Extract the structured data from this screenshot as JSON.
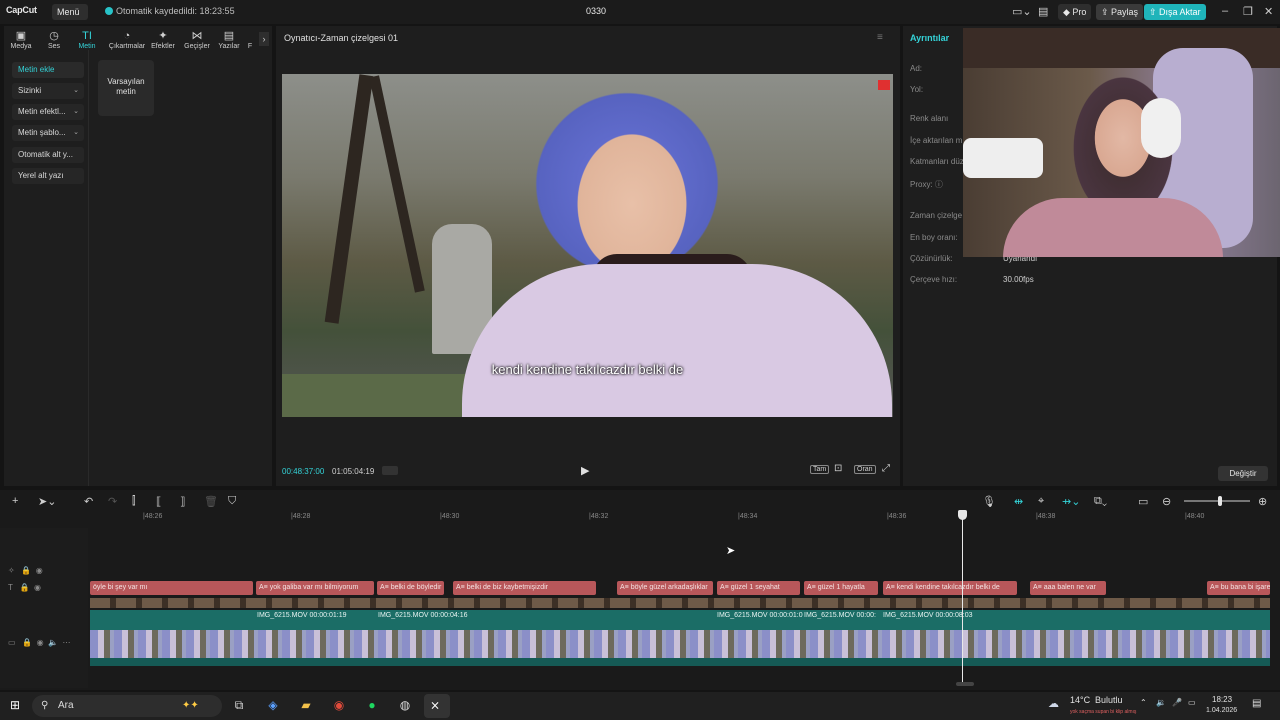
{
  "titlebar": {
    "logo": "CapCut",
    "menu": "Menü",
    "autosave": "Otomatik kaydedildi: 18:23:55",
    "project": "0330",
    "pro": "Pro",
    "share": "Paylaş",
    "export": "Dışa Aktar"
  },
  "tools": [
    {
      "label": "Medya",
      "icon": "▣"
    },
    {
      "label": "Ses",
      "icon": "◷"
    },
    {
      "label": "Metin",
      "icon": "TI"
    },
    {
      "label": "Çıkartmalar",
      "icon": "◔"
    },
    {
      "label": "Efektler",
      "icon": "✦"
    },
    {
      "label": "Geçişler",
      "icon": "⋈"
    },
    {
      "label": "Yazılar",
      "icon": "▤"
    },
    {
      "label": "F",
      "icon": "›"
    }
  ],
  "sidebar": [
    {
      "label": "Metin ekle",
      "active": true
    },
    {
      "label": "Sizinki"
    },
    {
      "label": "Metin efektl..."
    },
    {
      "label": "Metin şablo..."
    },
    {
      "label": "Otomatik alt y..."
    },
    {
      "label": "Yerel alt yazı"
    }
  ],
  "preset": {
    "line1": "Varsayılan",
    "line2": "metin"
  },
  "player": {
    "title": "Oynatıcı-Zaman çizelgesi 01",
    "subtitle": "kendi kendine takılcazdır belki de",
    "current_time": "00:48:37:00",
    "total_time": "01:05:04:19",
    "full": "Tam",
    "ratio": "Oran"
  },
  "details": {
    "title": "Ayrıntılar",
    "fields": [
      {
        "label": "Ad:",
        "value": ""
      },
      {
        "label": "Yol:",
        "value": ""
      },
      {
        "label": "Renk alanı",
        "value": ""
      },
      {
        "label": "İçe aktarılan m",
        "value": ""
      },
      {
        "label": "Katmanları düz",
        "value": ""
      },
      {
        "label": "Proxy:",
        "value": ""
      },
      {
        "label": "Zaman çizelge",
        "value": ""
      },
      {
        "label": "En boy oranı:",
        "value": ""
      },
      {
        "label": "Çözünürlük:",
        "value": "Uyarlandı"
      },
      {
        "label": "Çerçeve hızı:",
        "value": "30.00fps"
      }
    ],
    "change": "Değiştir"
  },
  "timeline": {
    "ruler": [
      "|48:26",
      "|48:28",
      "|48:30",
      "|48:32",
      "|48:34",
      "|48:36",
      "|48:38",
      "|48:40"
    ],
    "captions": [
      {
        "text": "öyle bi şey var mı"
      },
      {
        "text": "A≡ yok galiba var mı bilmiyorum"
      },
      {
        "text": "A≡ belki de böyledir"
      },
      {
        "text": "A≡ belki de biz kaybetmişizdir"
      },
      {
        "text": "A≡ böyle güzel arkadaşlıklar"
      },
      {
        "text": "A≡ güzel 1 seyahat"
      },
      {
        "text": "A≡ güzel 1 hayatla"
      },
      {
        "text": "A≡ kendi kendine takılcazdır belki de"
      },
      {
        "text": "A≡ aaa balen ne var"
      },
      {
        "text": "A≡ bu bana bi işare"
      }
    ],
    "clips": [
      {
        "text": "IMG_6215.MOV   00:00:01:19"
      },
      {
        "text": "IMG_6215.MOV   00:00:04:16"
      },
      {
        "text": "IMG_6215.MOV   00:00:01:0"
      },
      {
        "text": "IMG_6215.MOV   00:00:"
      },
      {
        "text": "IMG_6215.MOV   00:00:08:03"
      }
    ]
  },
  "taskbar": {
    "search": "Ara",
    "weather": "14°C",
    "weather_desc": "Bulutlu",
    "time": "18:23",
    "date": "1.04.2026",
    "ticker": "yok saçma supan bi klip almış"
  },
  "colors": {
    "accent": "#34d2d7",
    "caption": "#b8575a",
    "video_track": "#1b6d66",
    "export_btn": "#1fb4ba"
  }
}
